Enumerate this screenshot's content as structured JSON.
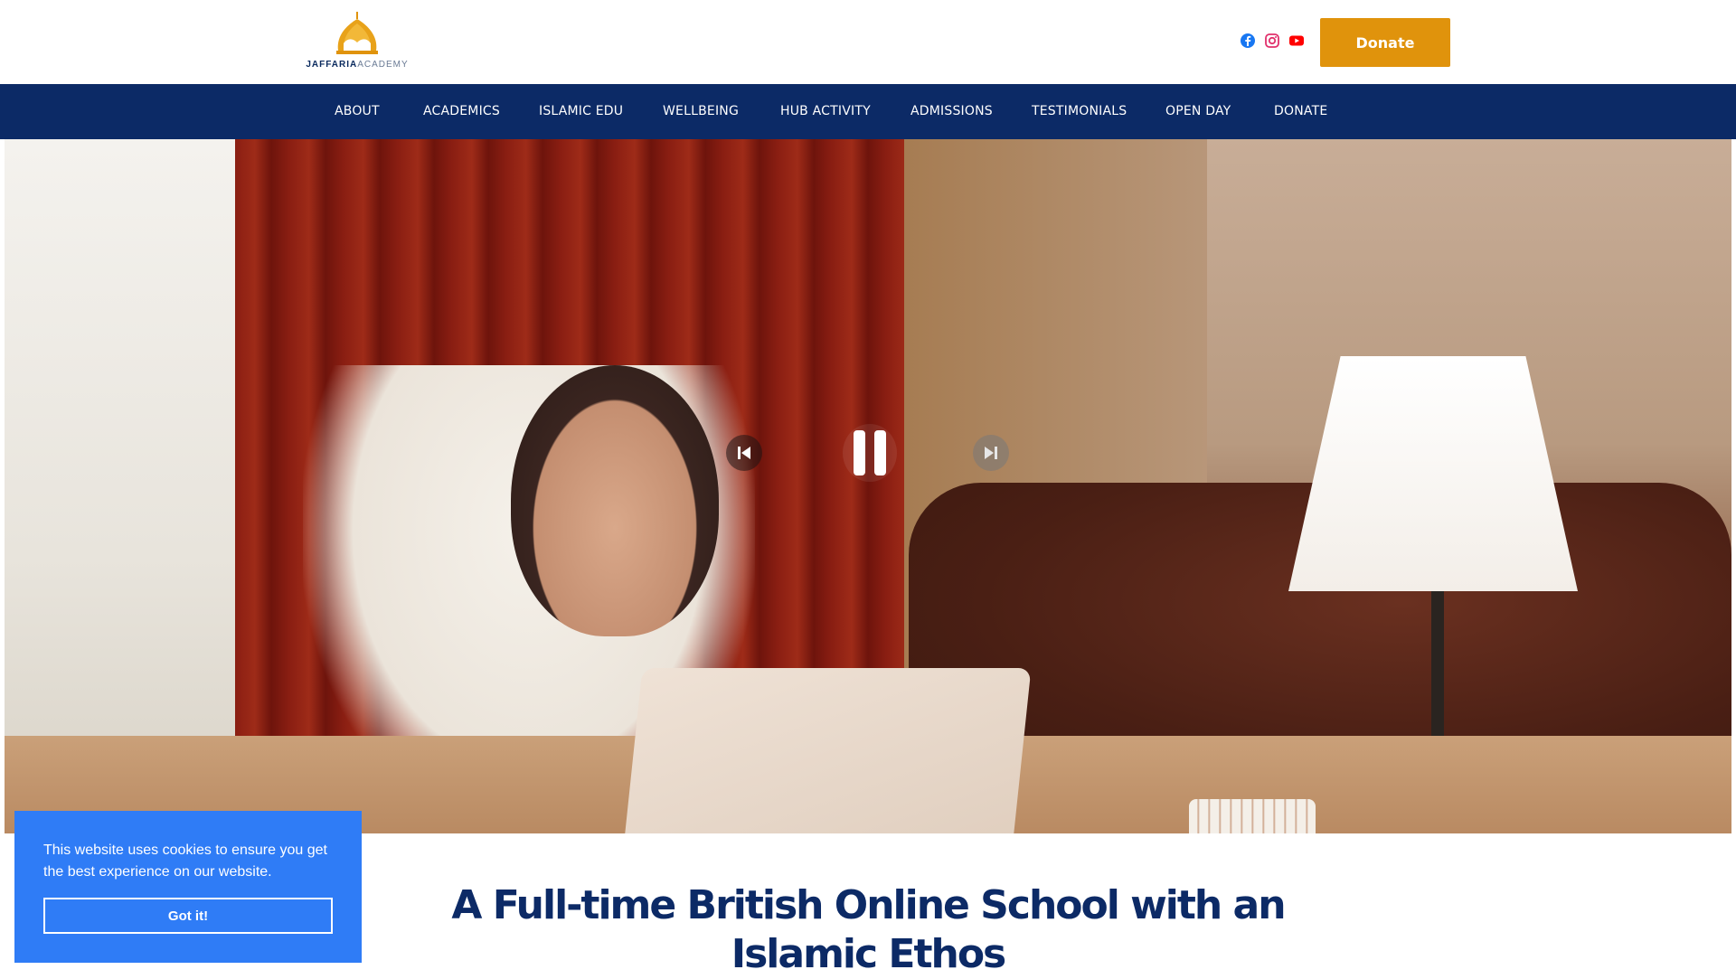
{
  "header": {
    "logo": {
      "name_bold": "JAFFARIA",
      "name_light": "ACADEMY"
    },
    "social": [
      {
        "icon": "facebook-icon",
        "color": "#1877f2"
      },
      {
        "icon": "instagram-icon",
        "color": "#e1306c"
      },
      {
        "icon": "youtube-icon",
        "color": "#ff0000"
      }
    ],
    "donate_label": "Donate"
  },
  "nav": {
    "items": [
      {
        "label": "ABOUT"
      },
      {
        "label": "ACADEMICS"
      },
      {
        "label": "ISLAMIC EDU"
      },
      {
        "label": "WELLBEING"
      },
      {
        "label": "HUB ACTIVITY"
      },
      {
        "label": "ADMISSIONS"
      },
      {
        "label": "TESTIMONIALS"
      },
      {
        "label": "OPEN DAY"
      },
      {
        "label": "DONATE"
      }
    ]
  },
  "hero": {
    "controls": {
      "prev_icon": "skip-back-icon",
      "pause_icon": "pause-icon",
      "next_icon": "skip-forward-icon"
    }
  },
  "cookie": {
    "message": "This website uses cookies to ensure you get the best experience on our website.",
    "button_label": "Got it!"
  },
  "main": {
    "headline_line1": "A Full-time British Online School with an",
    "headline_line2": "Islamic Ethos"
  },
  "colors": {
    "brand_navy": "#0c2a66",
    "donate_orange": "#e0930c",
    "cookie_blue": "#2f7cf6"
  }
}
